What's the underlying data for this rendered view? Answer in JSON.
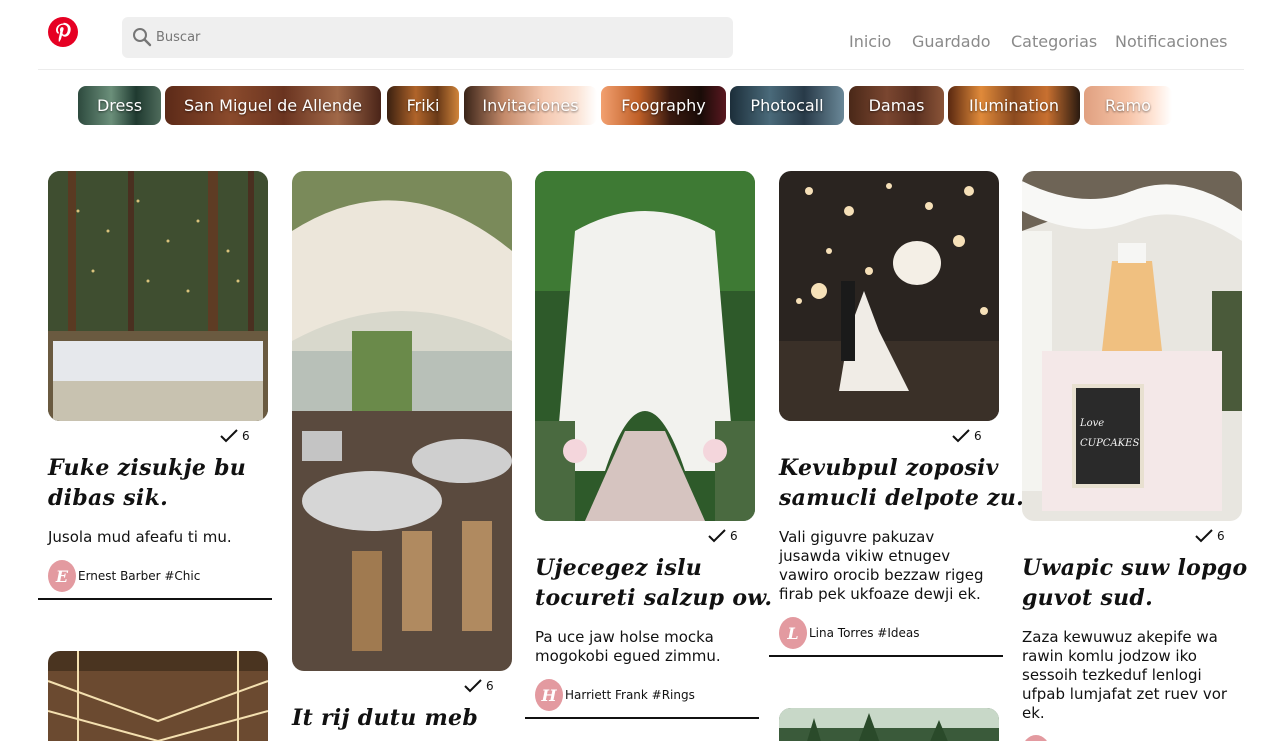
{
  "search": {
    "placeholder": "Buscar"
  },
  "nav": {
    "inicio": "Inicio",
    "guardado": "Guardado",
    "categorias": "Categorias",
    "notificaciones": "Notificaciones"
  },
  "chips": [
    "Dress",
    "San Miguel de Allende",
    "Friki",
    "Invitaciones",
    "Foography",
    "Photocall",
    "Damas",
    "Ilumination",
    "Ramo"
  ],
  "pins": [
    {
      "saves": "6",
      "title_l1": "Fuke zisukje bu",
      "title_l2": "dibas sik.",
      "desc_l1": "Jusola mud afeafu ti mu.",
      "avatar": "E",
      "author": "Ernest Barber #Chic"
    },
    {
      "saves": "6",
      "title_l1": "It rij dutu meb"
    },
    {
      "saves": "6",
      "title_l1": "Ujecegez islu",
      "title_l2": "tocureti salzup ow.",
      "desc_l1": "Pa uce jaw holse mocka",
      "desc_l2": "mogokobi egued zimmu.",
      "avatar": "H",
      "author": "Harriett Frank #Rings"
    },
    {
      "saves": "6",
      "title_l1": "Kevubpul zoposiv",
      "title_l2": "samucli delpote zu.",
      "desc_l1": "Vali giguvre pakuzav",
      "desc_l2": "jusawda vikiw etnugev",
      "desc_l3": "vawiro orocib bezzaw rigeg",
      "desc_l4": "firab pek ukfoaze dewji ek.",
      "avatar": "L",
      "author": "Lina Torres #Ideas"
    },
    {
      "saves": "6",
      "title_l1": "Uwapic suw lopgo",
      "title_l2": "guvot sud.",
      "desc_l1": "Zaza kewuwuz akepife wa",
      "desc_l2": "rawin komlu jodzow iko",
      "desc_l3": "sessoih tezkeduf lenlogi",
      "desc_l4": "ufpab lumjafat zet ruev vor",
      "desc_l5": "ek."
    }
  ]
}
